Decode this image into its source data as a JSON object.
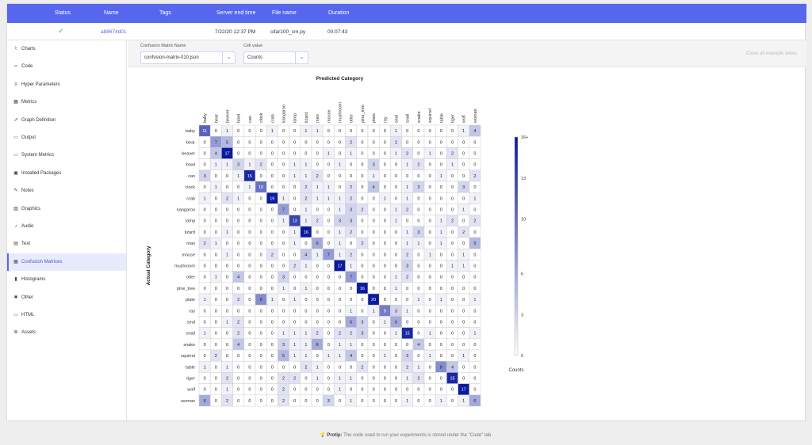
{
  "header": {
    "columns": [
      "Status",
      "Name",
      "Tags",
      "Server end time",
      "File name",
      "Duration"
    ]
  },
  "experiment": {
    "status_icon": "check-icon",
    "name": "a88674d01",
    "tags": "",
    "server_end_time": "7/22/20 12:37 PM",
    "file_name": "cifar100_cm.py",
    "duration": "00:07:43"
  },
  "sidebar": {
    "items": [
      {
        "label": "Charts",
        "icon": "line-chart-icon",
        "glyph": "⌇"
      },
      {
        "label": "Code",
        "icon": "code-icon",
        "glyph": "‹›"
      },
      {
        "label": "Hyper Parameters",
        "icon": "parameters-icon",
        "glyph": "≡"
      },
      {
        "label": "Metrics",
        "icon": "metrics-icon",
        "glyph": "▦"
      },
      {
        "label": "Graph Definition",
        "icon": "graph-icon",
        "glyph": "⇗"
      },
      {
        "label": "Output",
        "icon": "monitor-icon",
        "glyph": "▭"
      },
      {
        "label": "System Metrics",
        "icon": "system-icon",
        "glyph": "▭"
      },
      {
        "label": "Installed Packages",
        "icon": "package-icon",
        "glyph": "▣"
      },
      {
        "label": "Notes",
        "icon": "pencil-icon",
        "glyph": "✎"
      },
      {
        "label": "Graphics",
        "icon": "image-icon",
        "glyph": "▨"
      },
      {
        "label": "Audio",
        "icon": "music-note-icon",
        "glyph": "♪"
      },
      {
        "label": "Text",
        "icon": "text-icon",
        "glyph": "▤"
      },
      {
        "label": "Confusion Matrices",
        "icon": "grid-icon",
        "glyph": "▦"
      },
      {
        "label": "Histograms",
        "icon": "histogram-icon",
        "glyph": "▮"
      },
      {
        "label": "Other",
        "icon": "puzzle-icon",
        "glyph": "✱"
      },
      {
        "label": "HTML",
        "icon": "html-icon",
        "glyph": "▭"
      },
      {
        "label": "Assets",
        "icon": "assets-icon",
        "glyph": "≣"
      }
    ],
    "active_index": 12
  },
  "toolbar": {
    "matrix_label": "Confusion Matrix Name",
    "matrix_value": "confusion-matrix-010.json",
    "cell_label": "Cell value",
    "cell_value": "Counts",
    "close_all": "Close all example views"
  },
  "footer": {
    "protip_label": "Protip:",
    "protip_text": "The code used to run your experiments is stored under the \"Code\" tab."
  },
  "colors": {
    "header": "#5667ee",
    "accent": "#5667ee",
    "cell_max": "#0b1a9e"
  },
  "chart_data": {
    "type": "heatmap",
    "title": "Predicted Category",
    "xlabel": "Predicted Category",
    "ylabel": "Actual Category",
    "categories": [
      "baby",
      "bear",
      "beaver",
      "bowl",
      "can",
      "clock",
      "crab",
      "kangaroo",
      "lamp",
      "lizard",
      "man",
      "mouse",
      "mushroom",
      "otter",
      "pine_tree",
      "plate",
      "ray",
      "seal",
      "snail",
      "snake",
      "squirrel",
      "table",
      "tiger",
      "wolf",
      "woman"
    ],
    "matrix": [
      [
        11,
        0,
        1,
        0,
        0,
        0,
        1,
        0,
        0,
        1,
        1,
        0,
        0,
        0,
        0,
        0,
        0,
        1,
        0,
        0,
        0,
        0,
        0,
        1,
        4
      ],
      [
        0,
        7,
        5,
        0,
        0,
        0,
        0,
        0,
        0,
        0,
        0,
        0,
        0,
        2,
        0,
        0,
        0,
        2,
        0,
        0,
        0,
        0,
        0,
        0,
        0
      ],
      [
        0,
        4,
        17,
        0,
        0,
        0,
        0,
        0,
        0,
        0,
        0,
        1,
        0,
        1,
        0,
        0,
        0,
        1,
        2,
        0,
        1,
        0,
        2,
        0,
        0
      ],
      [
        0,
        1,
        1,
        3,
        1,
        2,
        0,
        0,
        1,
        1,
        0,
        0,
        1,
        0,
        0,
        3,
        0,
        0,
        1,
        2,
        0,
        0,
        1,
        0,
        0
      ],
      [
        3,
        0,
        0,
        1,
        15,
        0,
        0,
        0,
        1,
        1,
        2,
        0,
        0,
        0,
        0,
        1,
        0,
        0,
        0,
        0,
        0,
        1,
        0,
        0,
        2
      ],
      [
        0,
        1,
        0,
        0,
        1,
        10,
        0,
        0,
        0,
        2,
        1,
        1,
        0,
        2,
        0,
        4,
        0,
        0,
        1,
        3,
        0,
        0,
        0,
        3,
        0
      ],
      [
        1,
        0,
        2,
        1,
        0,
        0,
        19,
        1,
        0,
        2,
        1,
        1,
        1,
        2,
        0,
        0,
        1,
        0,
        1,
        0,
        0,
        0,
        0,
        0,
        1
      ],
      [
        0,
        0,
        0,
        0,
        0,
        0,
        0,
        7,
        0,
        1,
        0,
        0,
        1,
        3,
        2,
        0,
        0,
        1,
        2,
        0,
        0,
        0,
        0,
        1,
        0
      ],
      [
        0,
        0,
        0,
        0,
        0,
        0,
        0,
        1,
        13,
        1,
        2,
        0,
        3,
        3,
        0,
        0,
        0,
        1,
        0,
        0,
        0,
        1,
        2,
        0,
        2
      ],
      [
        0,
        0,
        1,
        0,
        0,
        0,
        0,
        0,
        1,
        16,
        0,
        0,
        1,
        2,
        0,
        0,
        0,
        0,
        1,
        3,
        0,
        1,
        0,
        2,
        0
      ],
      [
        2,
        1,
        0,
        0,
        0,
        0,
        0,
        0,
        1,
        0,
        6,
        0,
        1,
        0,
        2,
        0,
        0,
        0,
        1,
        1,
        0,
        1,
        0,
        0,
        5
      ],
      [
        0,
        0,
        1,
        0,
        0,
        0,
        2,
        0,
        0,
        4,
        1,
        7,
        1,
        2,
        0,
        0,
        0,
        0,
        2,
        0,
        1,
        0,
        0,
        1,
        0
      ],
      [
        0,
        0,
        0,
        0,
        0,
        0,
        0,
        0,
        2,
        1,
        0,
        0,
        17,
        1,
        0,
        0,
        0,
        0,
        3,
        0,
        0,
        0,
        1,
        1,
        0
      ],
      [
        0,
        1,
        0,
        4,
        0,
        0,
        0,
        3,
        0,
        0,
        0,
        0,
        0,
        7,
        0,
        0,
        0,
        1,
        2,
        0,
        0,
        0,
        0,
        0,
        0
      ],
      [
        0,
        0,
        0,
        0,
        0,
        0,
        0,
        1,
        0,
        1,
        0,
        0,
        0,
        0,
        16,
        0,
        0,
        1,
        0,
        0,
        0,
        0,
        0,
        0,
        0
      ],
      [
        1,
        0,
        0,
        2,
        0,
        8,
        1,
        0,
        1,
        0,
        0,
        0,
        0,
        0,
        0,
        20,
        0,
        0,
        0,
        1,
        0,
        1,
        0,
        0,
        1
      ],
      [
        0,
        0,
        0,
        0,
        0,
        0,
        0,
        0,
        0,
        0,
        0,
        0,
        0,
        1,
        0,
        1,
        9,
        3,
        1,
        0,
        0,
        0,
        0,
        0,
        0
      ],
      [
        0,
        0,
        1,
        2,
        0,
        0,
        0,
        0,
        0,
        0,
        0,
        0,
        0,
        6,
        3,
        0,
        1,
        6,
        0,
        0,
        0,
        0,
        0,
        0,
        0
      ],
      [
        1,
        0,
        0,
        2,
        0,
        0,
        0,
        1,
        1,
        1,
        2,
        0,
        2,
        2,
        3,
        0,
        0,
        1,
        15,
        0,
        1,
        0,
        0,
        0,
        1
      ],
      [
        0,
        0,
        0,
        4,
        0,
        0,
        0,
        3,
        1,
        1,
        6,
        0,
        1,
        1,
        0,
        0,
        0,
        0,
        0,
        4,
        0,
        0,
        0,
        0,
        0
      ],
      [
        0,
        2,
        0,
        0,
        0,
        0,
        0,
        5,
        1,
        1,
        0,
        1,
        1,
        4,
        0,
        0,
        1,
        0,
        3,
        0,
        1,
        0,
        0,
        1,
        0
      ],
      [
        1,
        0,
        1,
        0,
        0,
        0,
        0,
        0,
        0,
        2,
        1,
        0,
        0,
        0,
        2,
        0,
        0,
        0,
        2,
        1,
        0,
        8,
        4,
        0,
        0
      ],
      [
        0,
        0,
        2,
        0,
        0,
        0,
        0,
        2,
        2,
        0,
        1,
        0,
        1,
        1,
        0,
        0,
        0,
        0,
        1,
        2,
        0,
        0,
        15,
        0,
        0
      ],
      [
        0,
        0,
        1,
        0,
        0,
        0,
        0,
        2,
        0,
        0,
        0,
        0,
        1,
        0,
        0,
        0,
        0,
        0,
        0,
        0,
        0,
        0,
        0,
        17,
        0
      ],
      [
        6,
        0,
        2,
        0,
        0,
        0,
        0,
        2,
        0,
        0,
        0,
        3,
        0,
        1,
        0,
        0,
        0,
        0,
        1,
        0,
        0,
        1,
        0,
        1,
        6
      ]
    ],
    "colorbar": {
      "label": "Counts",
      "ticks": [
        0,
        3,
        6,
        10,
        13
      ],
      "tick_labels": [
        "0",
        "3",
        "6",
        "10",
        "13",
        "16+"
      ],
      "max": 16
    },
    "grid": true,
    "legend": "right"
  }
}
